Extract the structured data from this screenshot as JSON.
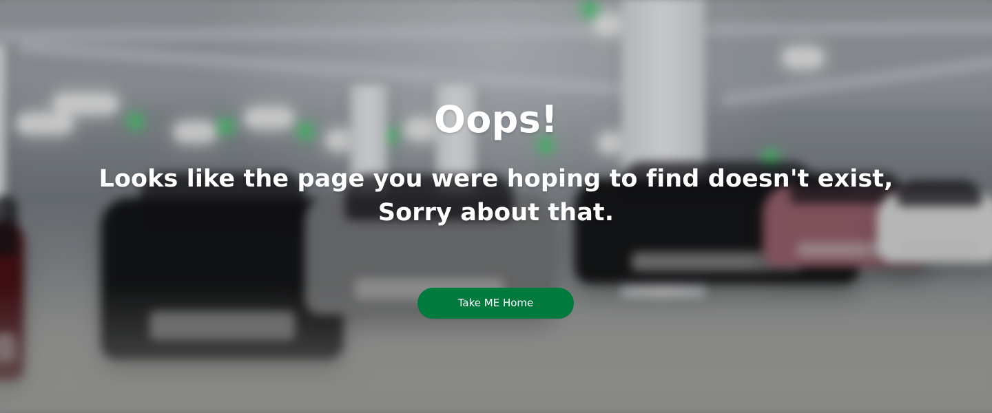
{
  "error_page": {
    "title": "Oops!",
    "message_line_1": "Looks like the page you were hoping to find doesn't exist,",
    "message_line_2": "Sorry about that.",
    "button_label": "Take ME Home"
  },
  "colors": {
    "button_background": "#007a3d",
    "text": "#ffffff"
  },
  "background": {
    "icon": "blurred-parking-garage-background"
  }
}
